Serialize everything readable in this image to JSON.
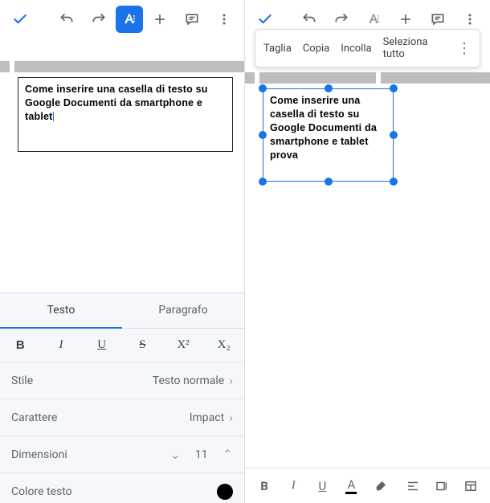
{
  "left": {
    "textbox": "Come inserire una casella di testo su Google Documenti da smartphone e tablet"
  },
  "right": {
    "context": {
      "cut": "Taglia",
      "copy": "Copia",
      "paste": "Incolla",
      "selectall": "Seleziona tutto"
    },
    "textbox": "Come inserire una casella di testo su Google Documenti da smartphone e tablet prova"
  },
  "panel": {
    "tab_text": "Testo",
    "tab_para": "Paragrafo",
    "fmt": {
      "b": "B",
      "i": "I",
      "u": "U",
      "s": "S",
      "sup": "X²",
      "sub": "X₂"
    },
    "style_label": "Stile",
    "style_val": "Testo normale",
    "font_label": "Carattere",
    "font_val": "Impact",
    "size_label": "Dimensioni",
    "size_val": "11",
    "color_label": "Colore testo"
  },
  "bottombar": {
    "b": "B",
    "i": "I",
    "u": "U",
    "a": "A"
  }
}
